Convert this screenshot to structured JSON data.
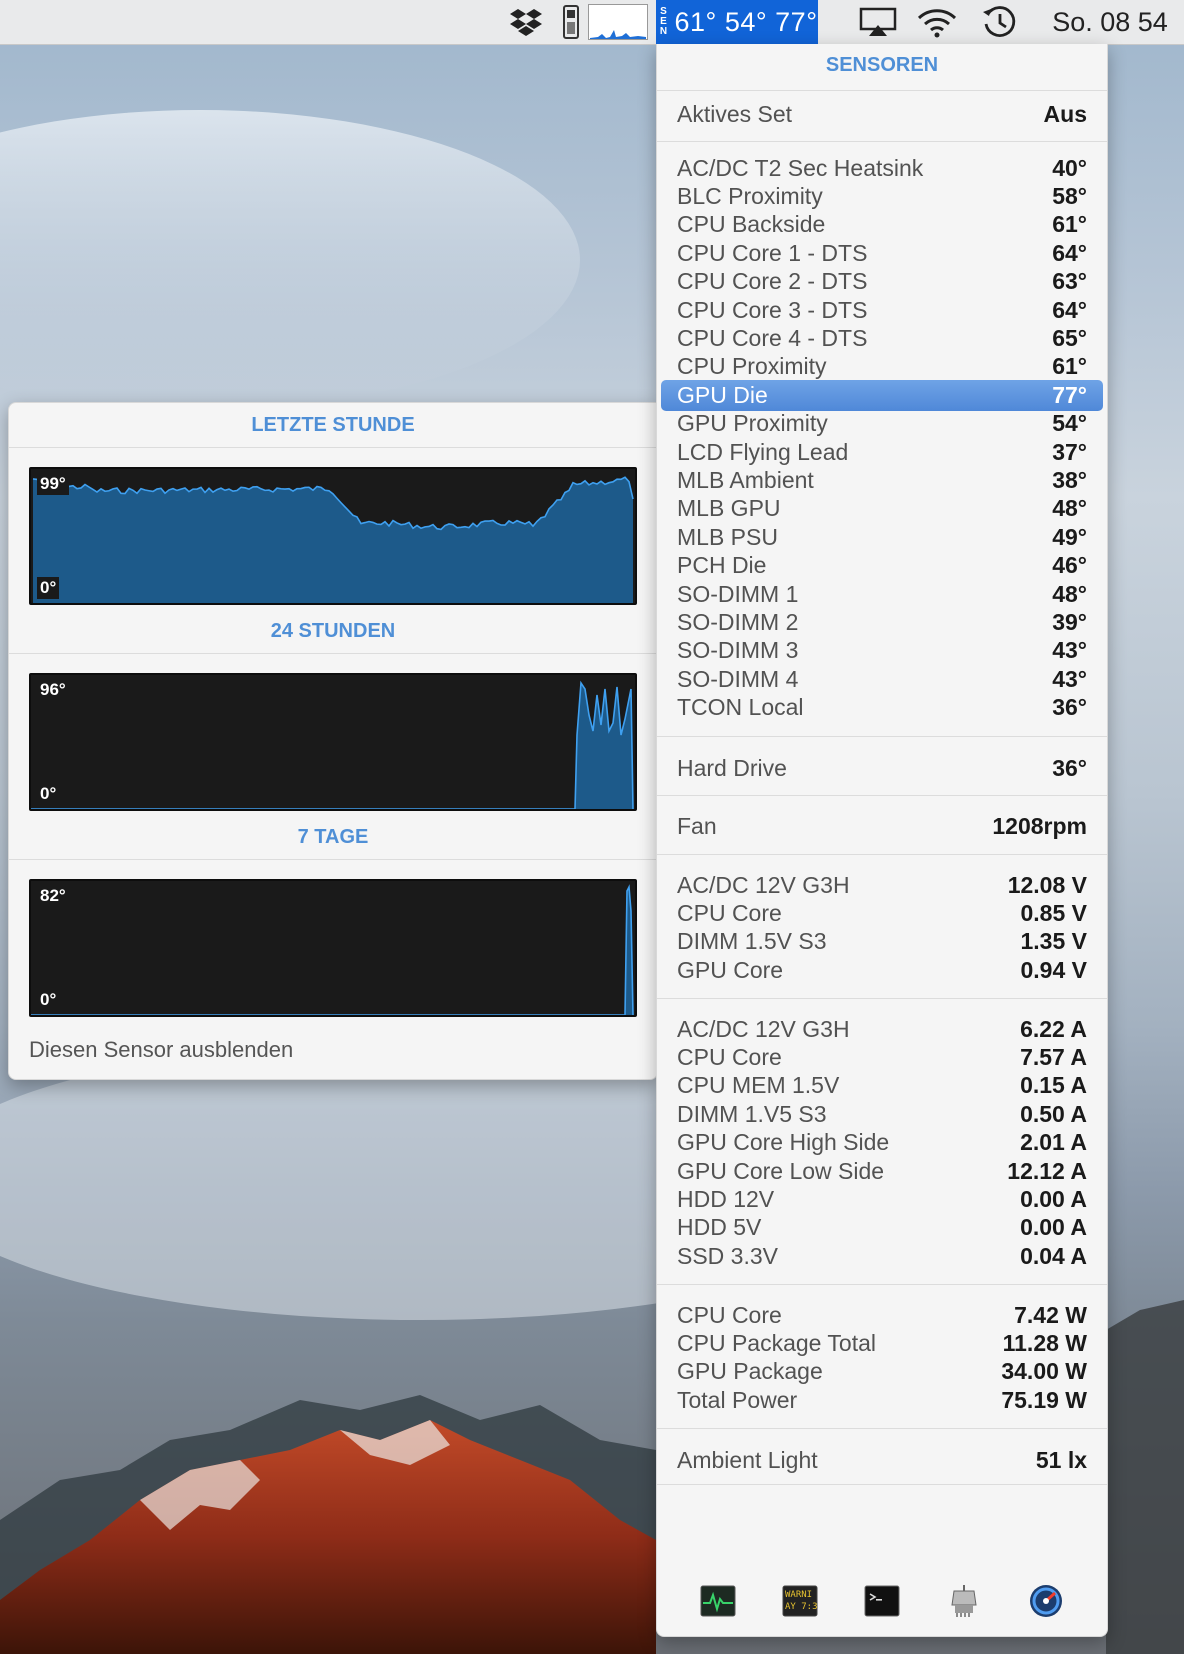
{
  "menubar": {
    "istat_label": "SENSORS",
    "istat_letters": [
      "S",
      "E",
      "N"
    ],
    "istat_temps": "61° 54° 77°",
    "clock": "So. 08 54",
    "icons": [
      "dropbox-icon",
      "cpu-icon",
      "cpu-history-graph-icon",
      "airplay-icon",
      "wifi-icon",
      "time-machine-icon"
    ]
  },
  "sensors": {
    "title": "SENSOREN",
    "active_set": {
      "label": "Aktives Set",
      "value": "Aus"
    },
    "temperatures": [
      {
        "name": "AC/DC T2 Sec Heatsink",
        "value": "40°"
      },
      {
        "name": "BLC Proximity",
        "value": "58°"
      },
      {
        "name": "CPU Backside",
        "value": "61°"
      },
      {
        "name": "CPU Core 1 - DTS",
        "value": "64°"
      },
      {
        "name": "CPU Core 2 - DTS",
        "value": "63°"
      },
      {
        "name": "CPU Core 3 - DTS",
        "value": "64°"
      },
      {
        "name": "CPU Core 4 - DTS",
        "value": "65°"
      },
      {
        "name": "CPU Proximity",
        "value": "61°"
      },
      {
        "name": "GPU Die",
        "value": "77°",
        "selected": true
      },
      {
        "name": "GPU Proximity",
        "value": "54°"
      },
      {
        "name": "LCD Flying Lead",
        "value": "37°"
      },
      {
        "name": "MLB Ambient",
        "value": "38°"
      },
      {
        "name": "MLB GPU",
        "value": "48°"
      },
      {
        "name": "MLB PSU",
        "value": "49°"
      },
      {
        "name": "PCH Die",
        "value": "46°"
      },
      {
        "name": "SO-DIMM 1",
        "value": "48°"
      },
      {
        "name": "SO-DIMM 2",
        "value": "39°"
      },
      {
        "name": "SO-DIMM 3",
        "value": "43°"
      },
      {
        "name": "SO-DIMM 4",
        "value": "43°"
      },
      {
        "name": "TCON Local",
        "value": "36°"
      }
    ],
    "drives": [
      {
        "name": "Hard Drive",
        "value": "36°"
      }
    ],
    "fans": [
      {
        "name": "Fan",
        "value": "1208rpm"
      }
    ],
    "voltages": [
      {
        "name": "AC/DC 12V G3H",
        "value": "12.08 V"
      },
      {
        "name": "CPU Core",
        "value": "0.85 V"
      },
      {
        "name": "DIMM 1.5V S3",
        "value": "1.35 V"
      },
      {
        "name": "GPU Core",
        "value": "0.94 V"
      }
    ],
    "currents": [
      {
        "name": "AC/DC 12V G3H",
        "value": "6.22 A"
      },
      {
        "name": "CPU Core",
        "value": "7.57 A"
      },
      {
        "name": "CPU MEM 1.5V",
        "value": "0.15 A"
      },
      {
        "name": "DIMM 1.V5 S3",
        "value": "0.50 A"
      },
      {
        "name": "GPU Core High Side",
        "value": "2.01 A"
      },
      {
        "name": "GPU Core Low Side",
        "value": "12.12 A"
      },
      {
        "name": "HDD 12V",
        "value": "0.00 A"
      },
      {
        "name": "HDD 5V",
        "value": "0.00 A"
      },
      {
        "name": "SSD 3.3V",
        "value": "0.04 A"
      }
    ],
    "power": [
      {
        "name": "CPU Core",
        "value": "7.42 W"
      },
      {
        "name": "CPU Package Total",
        "value": "11.28 W"
      },
      {
        "name": "GPU Package",
        "value": "34.00 W"
      },
      {
        "name": "Total Power",
        "value": "75.19 W"
      }
    ],
    "light": [
      {
        "name": "Ambient Light",
        "value": "51 lx"
      }
    ],
    "toolbar": [
      "activity-monitor-icon",
      "console-icon",
      "terminal-icon",
      "system-information-icon",
      "istat-icon"
    ],
    "toolbar_console_text": [
      "WARNI",
      "AY 7:36"
    ]
  },
  "history": {
    "sections": [
      {
        "title": "LETZTE STUNDE",
        "max": "99°",
        "min": "0°"
      },
      {
        "title": "24 STUNDEN",
        "max": "96°",
        "min": "0°"
      },
      {
        "title": "7 TAGE",
        "max": "82°",
        "min": "0°"
      }
    ],
    "hide_label": "Diesen Sensor ausblenden"
  },
  "colors": {
    "accent": "#4f8fd6",
    "selection": "#5b93dc",
    "menubar_highlight": "#1164d8",
    "graph_fill": "#1d5a8a",
    "graph_line": "#3fa0f0"
  }
}
